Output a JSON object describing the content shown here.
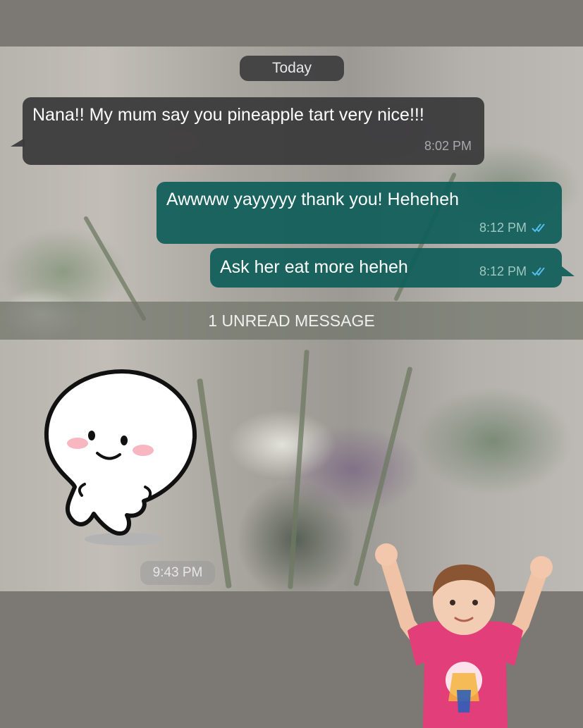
{
  "chat": {
    "date_label": "Today",
    "messages": [
      {
        "direction": "incoming",
        "text": "Nana!! My mum say you pineapple tart very nice!!!",
        "time": "8:02 PM"
      },
      {
        "direction": "outgoing",
        "text": "Awwww yayyyyy thank you! Heheheh",
        "time": "8:12 PM",
        "status_icon": "double-check-read-icon"
      },
      {
        "direction": "outgoing",
        "text": "Ask her eat more heheh",
        "time": "8:12 PM",
        "status_icon": "double-check-read-icon"
      }
    ],
    "unread_banner": "1 UNREAD MESSAGE",
    "sticker": {
      "icon": "white-blob-character-sticker",
      "time": "9:43 PM"
    }
  },
  "overlay": {
    "kid_sticker_icon": "cheering-toddler-sticker"
  },
  "colors": {
    "incoming_bubble": "#3a3a3c",
    "outgoing_bubble": "#115f5a",
    "read_ticks": "#53bdeb",
    "background_band": "#7c7874"
  }
}
